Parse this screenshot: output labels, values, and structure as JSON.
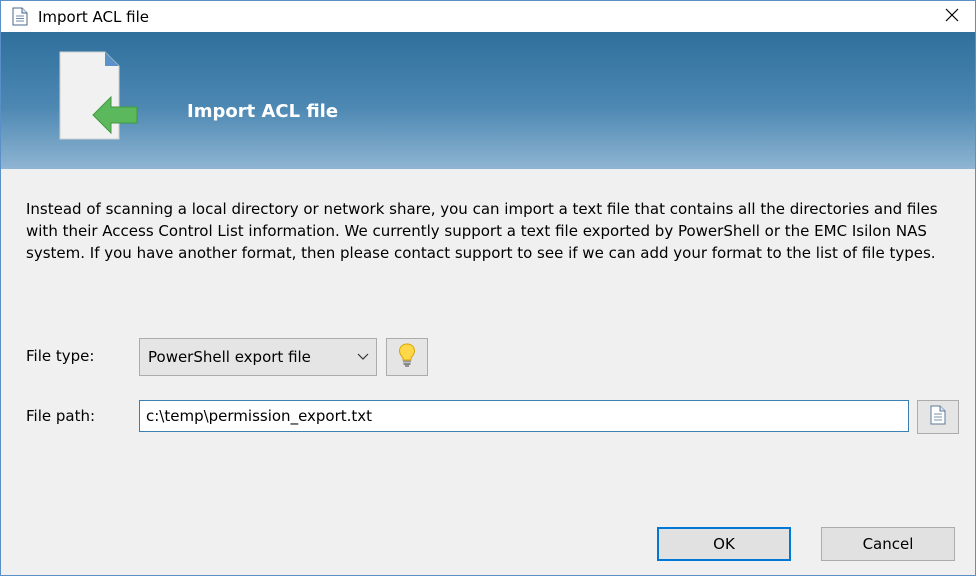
{
  "window": {
    "title": "Import ACL file"
  },
  "banner": {
    "title": "Import ACL file"
  },
  "description": "Instead of scanning a local directory or network share, you can import a text file that contains all the directories and files with their Access Control List information. We currently support a text file exported by PowerShell or the EMC Isilon NAS system. If you have another format, then please contact support to see if we can add your format to the list of file types.",
  "form": {
    "file_type_label": "File type:",
    "file_type_value": "PowerShell export file",
    "file_path_label": "File path:",
    "file_path_value": "c:\\temp\\permission_export.txt"
  },
  "buttons": {
    "ok": "OK",
    "cancel": "Cancel"
  },
  "icons": {
    "title": "document-icon",
    "banner": "import-file-icon",
    "tip": "lightbulb-icon",
    "browse": "document-icon",
    "close": "close-icon",
    "dropdown": "chevron-down-icon"
  },
  "colors": {
    "banner_top": "#2f6f9c",
    "banner_bottom": "#8fb5d2",
    "accent": "#0078d7"
  }
}
